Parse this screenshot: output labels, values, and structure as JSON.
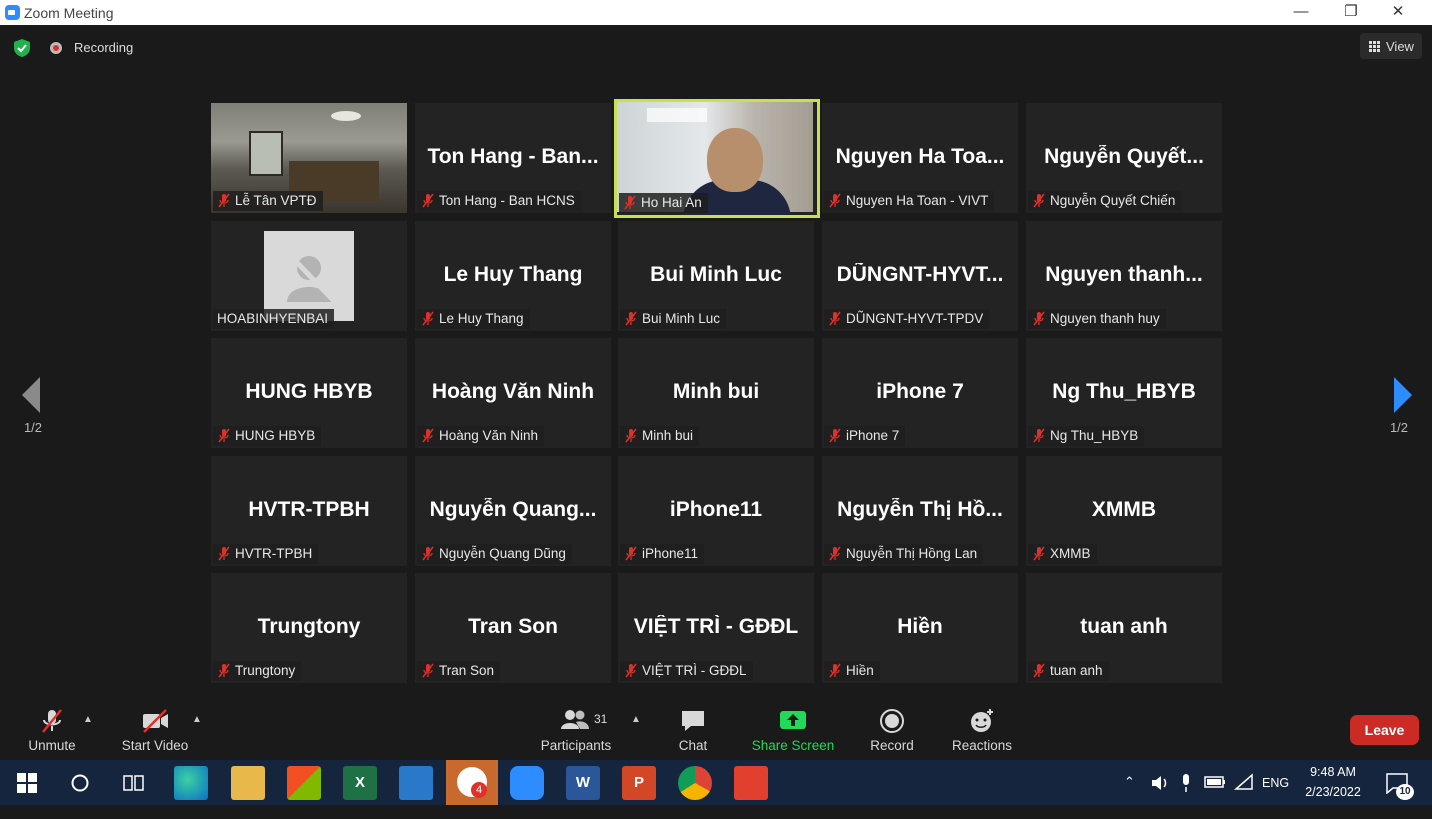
{
  "window": {
    "title": "Zoom Meeting",
    "minimize": "—",
    "restore": "❐",
    "close": "✕"
  },
  "topbar": {
    "recording_label": "Recording",
    "view_label": "View"
  },
  "pager": {
    "left": "1/2",
    "right": "1/2"
  },
  "participants": [
    {
      "display": "",
      "tag": "Lễ Tân VPTĐ",
      "video": "room"
    },
    {
      "display": "Ton Hang - Ban...",
      "tag": "Ton Hang - Ban HCNS"
    },
    {
      "display": "",
      "tag": "Ho Hai An",
      "video": "cam",
      "active": true
    },
    {
      "display": "Nguyen Ha Toa...",
      "tag": "Nguyen Ha Toan - VIVT"
    },
    {
      "display": "Nguyễn Quyết...",
      "tag": "Nguyễn Quyết Chiến"
    },
    {
      "display": "",
      "tag": "HOABINHYENBAI",
      "video": "placeholder",
      "nomic": true
    },
    {
      "display": "Le Huy Thang",
      "tag": "Le Huy Thang"
    },
    {
      "display": "Bui Minh Luc",
      "tag": "Bui Minh Luc"
    },
    {
      "display": "DŨNGNT-HYVT...",
      "tag": "DŨNGNT-HYVT-TPDV"
    },
    {
      "display": "Nguyen thanh...",
      "tag": "Nguyen thanh huy"
    },
    {
      "display": "HUNG HBYB",
      "tag": "HUNG HBYB"
    },
    {
      "display": "Hoàng Văn Ninh",
      "tag": "Hoàng Văn Ninh"
    },
    {
      "display": "Minh bui",
      "tag": "Minh bui"
    },
    {
      "display": "iPhone 7",
      "tag": "iPhone 7"
    },
    {
      "display": "Ng Thu_HBYB",
      "tag": "Ng Thu_HBYB"
    },
    {
      "display": "HVTR-TPBH",
      "tag": "HVTR-TPBH"
    },
    {
      "display": "Nguyễn Quang...",
      "tag": "Nguyễn Quang Dũng"
    },
    {
      "display": "iPhone11",
      "tag": "iPhone11"
    },
    {
      "display": "Nguyễn Thị Hồ...",
      "tag": "Nguyễn Thị Hồng Lan"
    },
    {
      "display": "XMMB",
      "tag": "XMMB"
    },
    {
      "display": "Trungtony",
      "tag": "Trungtony"
    },
    {
      "display": "Tran Son",
      "tag": "Tran Son"
    },
    {
      "display": "VIỆT TRÌ - GĐĐL",
      "tag": "VIỆT TRÌ - GĐĐL"
    },
    {
      "display": "Hiền",
      "tag": "Hiền"
    },
    {
      "display": "tuan anh",
      "tag": "tuan anh"
    }
  ],
  "toolbar": {
    "unmute": "Unmute",
    "start_video": "Start Video",
    "participants": "Participants",
    "participants_count": "31",
    "chat": "Chat",
    "share_screen": "Share Screen",
    "record": "Record",
    "reactions": "Reactions",
    "leave": "Leave"
  },
  "taskbar": {
    "zoom_badge": "4",
    "lang": "ENG",
    "time": "9:48 AM",
    "date": "2/23/2022",
    "notifications": "10"
  },
  "colors": {
    "active_border": "#c7e052",
    "share_green": "#23d959",
    "leave_red": "#cc2a24",
    "muted_red": "#e0302a"
  }
}
